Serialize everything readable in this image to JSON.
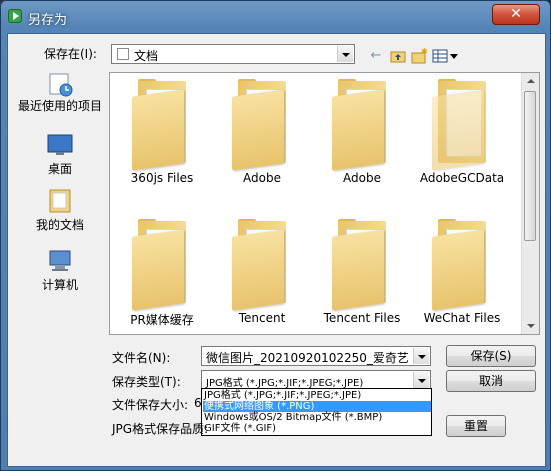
{
  "dialog": {
    "title": "另存为",
    "close_label": "✕"
  },
  "save_in": {
    "label": "保存在(I):",
    "value": "文档"
  },
  "toolbar": {
    "back_icon": "back-arrow-icon",
    "up_icon": "up-folder-icon",
    "new_folder_icon": "new-folder-icon",
    "views_icon": "views-menu-icon"
  },
  "places": [
    {
      "label": "最近使用的项目",
      "icon": "recent-items-icon"
    },
    {
      "label": "桌面",
      "icon": "desktop-icon"
    },
    {
      "label": "我的文档",
      "icon": "my-documents-icon"
    },
    {
      "label": "计算机",
      "icon": "computer-icon"
    }
  ],
  "files": [
    {
      "name": "360js Files"
    },
    {
      "name": "Adobe"
    },
    {
      "name": "Adobe"
    },
    {
      "name": "AdobeGCData"
    },
    {
      "name": "PR媒体缓存"
    },
    {
      "name": "Tencent"
    },
    {
      "name": "Tencent Files"
    },
    {
      "name": "WeChat Files"
    }
  ],
  "filename": {
    "label": "文件名(N):",
    "value": "微信图片_20210920102250_爱奇艺"
  },
  "filetype": {
    "label": "保存类型(T):",
    "value": "JPG格式 (*.JPG;*.JIF;*.JPEG;*.JPE)",
    "options": [
      "JPG格式 (*.JPG;*.JIF;*.JPEG;*.JPE)",
      "便携式网络图象 (*.PNG)",
      "Windows或OS/2 Bitmap文件 (*.BMP)",
      "GIF文件 (*.GIF)"
    ],
    "highlighted_index": 1
  },
  "filesize": {
    "label": "文件保存大小:",
    "value_prefix": "6"
  },
  "quality": {
    "label": "JPG格式保存品质:"
  },
  "buttons": {
    "save": "保存(S)",
    "cancel": "取消",
    "reset": "重置"
  },
  "colors": {
    "title_bar": "#5584b6",
    "close_button": "#c9432c",
    "selection": "#3399ff",
    "folder": "#f0d27f"
  }
}
